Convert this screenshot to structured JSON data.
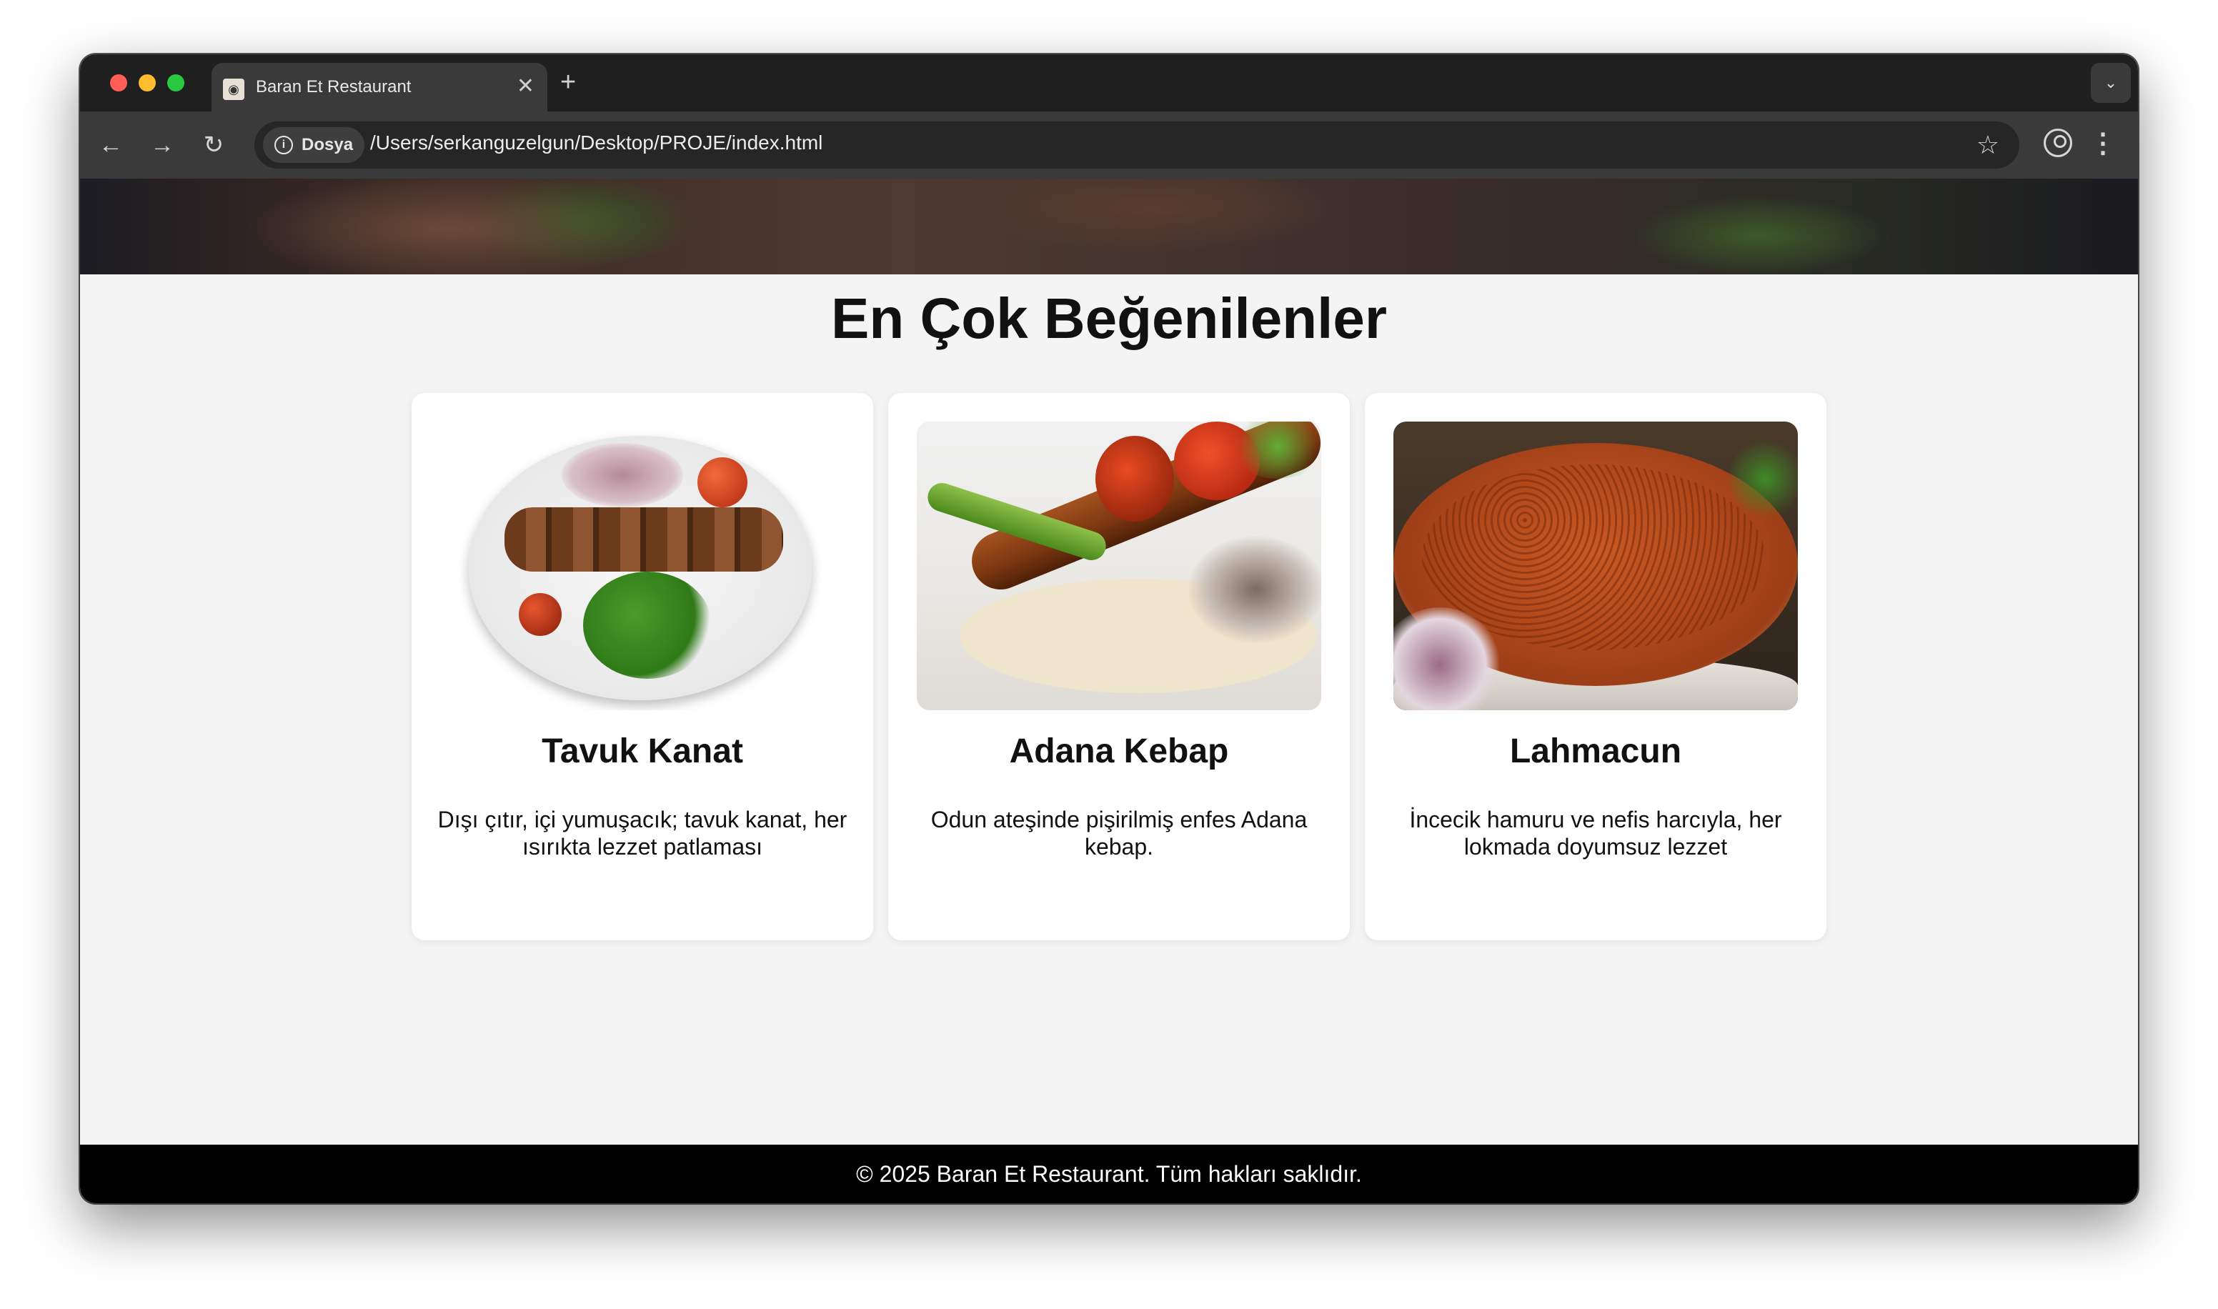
{
  "browser": {
    "tab_title": "Baran Et Restaurant",
    "tab_close": "✕",
    "new_tab": "+",
    "address_chip": "Dosya",
    "url": "/Users/serkanguzelgun/Desktop/PROJE/index.html"
  },
  "page": {
    "section_title": "En Çok Beğenilenler",
    "cards": [
      {
        "title": "Tavuk Kanat",
        "description": "Dışı çıtır, içi yumuşacık; tavuk kanat, her ısırıkta lezzet patlaması"
      },
      {
        "title": "Adana Kebap",
        "description": "Odun ateşinde pişirilmiş enfes Adana kebap."
      },
      {
        "title": "Lahmacun",
        "description": "İncecik hamuru ve nefis harcıyla, her lokmada doyumsuz lezzet"
      }
    ],
    "footer": "© 2025 Baran Et Restaurant. Tüm hakları saklıdır."
  },
  "icons": {
    "back": "arrow-left-icon",
    "forward": "arrow-right-icon",
    "reload": "reload-icon",
    "info": "info-icon",
    "bookmark": "star-icon",
    "profile": "profile-icon",
    "menu": "more-vert-icon"
  },
  "colors": {
    "page_background": "#f4f4f4",
    "footer_background": "#000000",
    "card_background": "#ffffff"
  }
}
